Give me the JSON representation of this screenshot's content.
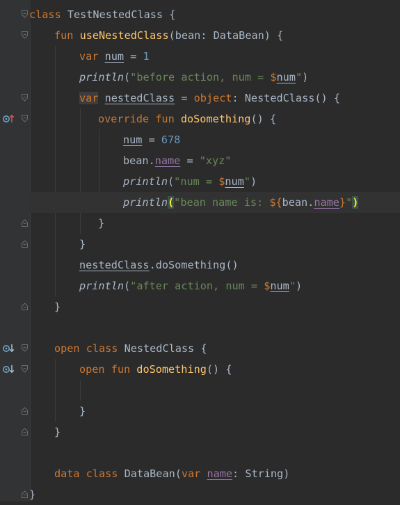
{
  "editor": {
    "language": "Kotlin",
    "theme_colors": {
      "background": "#2b2b2b",
      "keyword": "#cc7832",
      "function": "#ffc66d",
      "string": "#6a8759",
      "number": "#6897bb",
      "property": "#9876aa",
      "default": "#a9b7c6"
    },
    "gutter_icons": [
      {
        "line": 6,
        "icon": "override-up-arrow-icon"
      },
      {
        "line": 17,
        "icon": "implemented-down-arrow-icon"
      },
      {
        "line": 18,
        "icon": "implemented-down-arrow-icon"
      }
    ],
    "lines": [
      {
        "t1": "class",
        "t2": " TestNestedClass {"
      },
      {
        "t1": "fun ",
        "t2": "useNestedClass",
        "t3": "(bean: DataBean) {"
      },
      {
        "t1": "var ",
        "t2": "num",
        "t3": " = ",
        "t4": "1"
      },
      {
        "t1": "println",
        "t2": "(",
        "t3": "\"before action, num = ",
        "t4": "$",
        "t5": "num",
        "t6": "\"",
        "t7": ")"
      },
      {
        "t1": "var",
        "t2": " ",
        "t3": "nestedClass",
        "t4": " = ",
        "t5": "object",
        "t6": ": NestedClass() {"
      },
      {
        "t1": "override fun ",
        "t2": "doSomething",
        "t3": "() {"
      },
      {
        "t1": "num",
        "t2": " = ",
        "t3": "678"
      },
      {
        "t1": "bean.",
        "t2": "name",
        "t3": " = ",
        "t4": "\"xyz\""
      },
      {
        "t1": "println",
        "t2": "(",
        "t3": "\"num = ",
        "t4": "$",
        "t5": "num",
        "t6": "\"",
        "t7": ")"
      },
      {
        "t1": "println",
        "t2": "(",
        "t3": "\"bean name is: ",
        "t4": "${",
        "t5": "bean.",
        "t6": "name",
        "t7": "}",
        "t8": "\"",
        "t9": ")"
      },
      {
        "t1": "}"
      },
      {
        "t1": "}"
      },
      {
        "t1": "nestedClass",
        "t2": ".doSomething()"
      },
      {
        "t1": "println",
        "t2": "(",
        "t3": "\"after action, num = ",
        "t4": "$",
        "t5": "num",
        "t6": "\"",
        "t7": ")"
      },
      {
        "t1": "}"
      },
      {
        "t1": ""
      },
      {
        "t1": "open class ",
        "t2": "NestedClass {"
      },
      {
        "t1": "open fun ",
        "t2": "doSomething",
        "t3": "() {"
      },
      {
        "t1": ""
      },
      {
        "t1": "}"
      },
      {
        "t1": "}"
      },
      {
        "t1": ""
      },
      {
        "t1": "data class ",
        "t2": "DataBean(",
        "t3": "var ",
        "t4": "name",
        "t5": ": String)"
      },
      {
        "t1": "}"
      }
    ]
  }
}
